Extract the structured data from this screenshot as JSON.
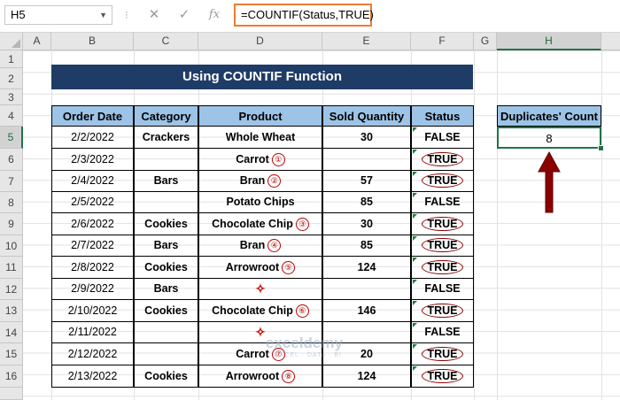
{
  "formula_bar": {
    "name_box": "H5",
    "formula": "=COUNTIF(Status,TRUE)"
  },
  "columns": [
    "A",
    "B",
    "C",
    "D",
    "E",
    "F",
    "G",
    "H"
  ],
  "rows": [
    "1",
    "2",
    "3",
    "4",
    "5",
    "6",
    "7",
    "8",
    "9",
    "10",
    "11",
    "12",
    "13",
    "14",
    "15",
    "16"
  ],
  "title": "Using COUNTIF Function",
  "table": {
    "headers": [
      "Order Date",
      "Category",
      "Product",
      "Sold Quantity",
      "Status"
    ],
    "rows": [
      {
        "date": "2/2/2022",
        "category": "Crackers",
        "product": "Whole Wheat",
        "qty": "30",
        "status": "FALSE"
      },
      {
        "date": "2/3/2022",
        "category": "",
        "product": "Carrot",
        "qty": "",
        "status": "TRUE"
      },
      {
        "date": "2/4/2022",
        "category": "Bars",
        "product": "Bran",
        "qty": "57",
        "status": "TRUE"
      },
      {
        "date": "2/5/2022",
        "category": "",
        "product": "Potato Chips",
        "qty": "85",
        "status": "FALSE"
      },
      {
        "date": "2/6/2022",
        "category": "Cookies",
        "product": "Chocolate Chip",
        "qty": "30",
        "status": "TRUE"
      },
      {
        "date": "2/7/2022",
        "category": "Bars",
        "product": "Bran",
        "qty": "85",
        "status": "TRUE"
      },
      {
        "date": "2/8/2022",
        "category": "Cookies",
        "product": "Arrowroot",
        "qty": "124",
        "status": "TRUE"
      },
      {
        "date": "2/9/2022",
        "category": "Bars",
        "product": "",
        "qty": "",
        "status": "FALSE"
      },
      {
        "date": "2/10/2022",
        "category": "Cookies",
        "product": "Chocolate Chip",
        "qty": "146",
        "status": "TRUE"
      },
      {
        "date": "2/11/2022",
        "category": "",
        "product": "",
        "qty": "",
        "status": "FALSE"
      },
      {
        "date": "2/12/2022",
        "category": "",
        "product": "Carrot",
        "qty": "20",
        "status": "TRUE"
      },
      {
        "date": "2/13/2022",
        "category": "Cookies",
        "product": "Arrowroot",
        "qty": "124",
        "status": "TRUE"
      }
    ],
    "markers": [
      "",
      "①",
      "②",
      "",
      "③",
      "④",
      "⑤",
      "",
      "⑥",
      "",
      "⑦",
      "⑧"
    ]
  },
  "result": {
    "header": "Duplicates' Count",
    "value": "8"
  },
  "watermark": {
    "brand": "exceldemy",
    "tagline": "EXCEL · DATA · BI"
  },
  "colors": {
    "title_bg": "#1f3c66",
    "header_bg": "#9dc3e6",
    "accent": "#8b0000",
    "selection": "#217346"
  }
}
